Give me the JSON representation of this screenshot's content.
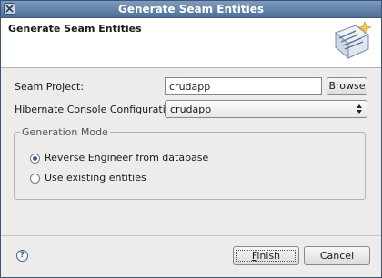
{
  "window": {
    "title": "Generate Seam Entities",
    "close_icon": "close-icon"
  },
  "banner": {
    "heading": "Generate Seam Entities",
    "logo_icon": "seam-wizard-icon"
  },
  "form": {
    "seam_project_label": "Seam Project:",
    "seam_project_value": "crudapp",
    "browse_label": "Browse",
    "hibernate_label": "Hibernate Console Configuration:",
    "hibernate_value": "crudapp"
  },
  "generation_mode": {
    "legend": "Generation Mode",
    "options": [
      {
        "label": "Reverse Engineer from database",
        "selected": true
      },
      {
        "label": "Use existing entities",
        "selected": false
      }
    ]
  },
  "footer": {
    "help_icon": "help-icon",
    "finish_mnemonic": "F",
    "finish_rest": "inish",
    "cancel_label": "Cancel"
  },
  "colors": {
    "titlebar": "#5a7aa3",
    "dialog_bg": "#edeceb",
    "accent": "#3d5f8e"
  }
}
